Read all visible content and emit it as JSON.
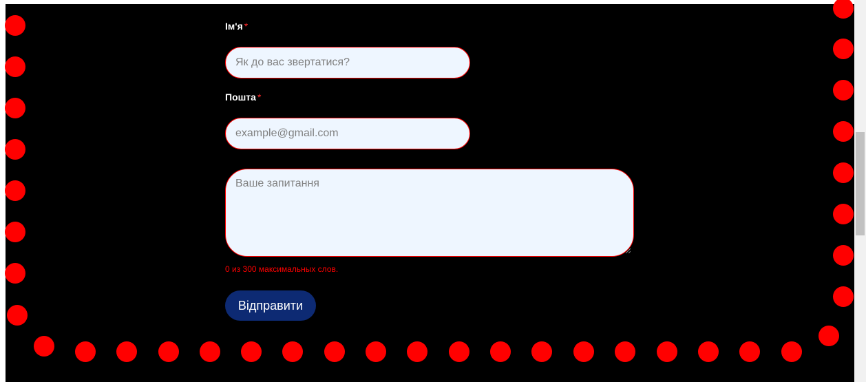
{
  "colors": {
    "background": "#000000",
    "accent_red": "#ff0000",
    "input_bg": "#eef6ff",
    "button_bg": "#0d2a73"
  },
  "form": {
    "name_label": "Ім'я",
    "name_required": "*",
    "name_placeholder": "Як до вас звертатися?",
    "email_label": "Пошта",
    "email_required": "*",
    "email_placeholder": "example@gmail.com",
    "question_placeholder": "Ваше запитання",
    "word_counter": "0 из 300 максимальных слов.",
    "submit_label": "Відправити"
  },
  "decoration": {
    "dot_icon": "red-dot-icon"
  }
}
